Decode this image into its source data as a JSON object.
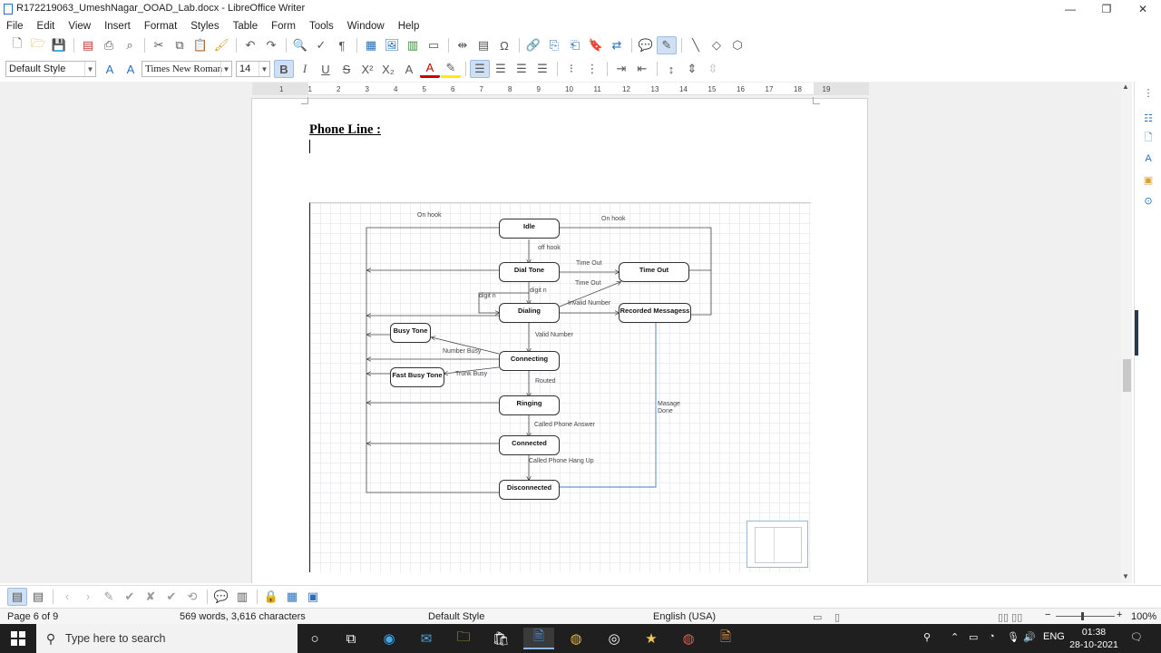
{
  "window": {
    "title": "R172219063_UmeshNagar_OOAD_Lab.docx - LibreOffice Writer",
    "minimize": "—",
    "maximize": "❐",
    "close": "✕"
  },
  "menu": [
    "File",
    "Edit",
    "View",
    "Insert",
    "Format",
    "Styles",
    "Table",
    "Form",
    "Tools",
    "Window",
    "Help"
  ],
  "formatting": {
    "paragraph_style": "Default Style",
    "font_name": "Times New Roman",
    "font_size": "14"
  },
  "ruler": {
    "ticks": [
      "1",
      "1",
      "2",
      "3",
      "4",
      "5",
      "6",
      "7",
      "8",
      "9",
      "10",
      "11",
      "12",
      "13",
      "14",
      "15",
      "16",
      "17",
      "18",
      "19"
    ]
  },
  "document": {
    "heading": "Phone Line :"
  },
  "diagram": {
    "states": {
      "idle": "Idle",
      "dial_tone": "Dial Tone",
      "time_out": "Time Out",
      "dialing": "Dialing",
      "recorded": "Recorded Messagess",
      "busy_tone": "Busy Tone",
      "connecting": "Connecting",
      "fast_busy": "Fast Busy Tone",
      "ringing": "Ringing",
      "connected": "Connected",
      "disconnected": "Disconnected"
    },
    "labels": {
      "on_hook_left": "On hook",
      "on_hook_right": "On hook",
      "off_hook": "off hook",
      "time_out_1": "Time Out",
      "time_out_2": "Time Out",
      "digit_n_1": "digit n",
      "digit_n_2": "digit n",
      "invalid_number": "Invalid Number",
      "valid_number": "Valid Number",
      "number_busy": "Number Busy",
      "trunk_busy": "Trunk Busy",
      "routed": "Routed",
      "called_phone_answer": "Called Phone Answer",
      "called_phone_hang_up": "Called Phone Hang Up",
      "masage": "Masage",
      "done": "Done"
    }
  },
  "status": {
    "page": "Page 6 of 9",
    "words": "569 words, 3,616 characters",
    "style": "Default Style",
    "language": "English (USA)",
    "zoom": "100%"
  },
  "taskbar": {
    "search_placeholder": "Type here to search",
    "lang": "ENG",
    "time": "01:38",
    "date": "28-10-2021"
  }
}
